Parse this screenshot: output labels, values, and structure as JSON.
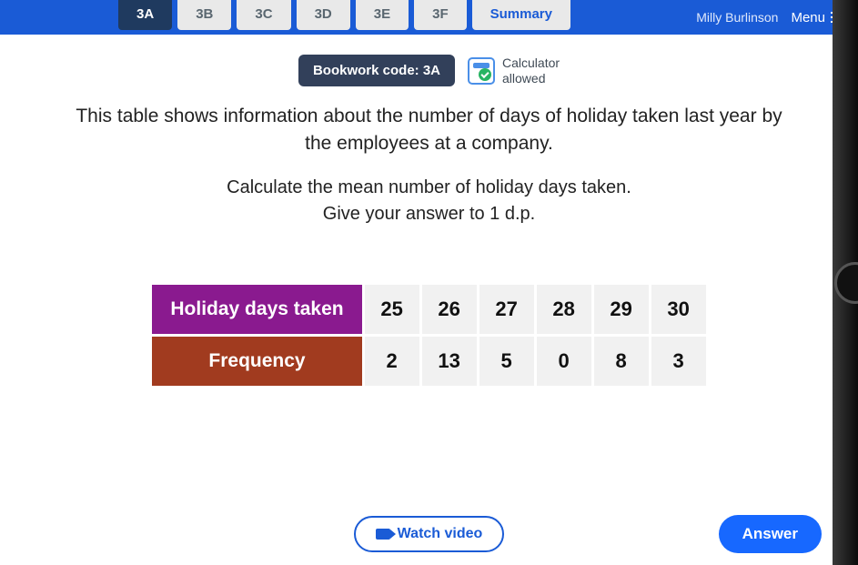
{
  "topbar": {
    "user": "Milly Burlinson",
    "menu": "Menu",
    "tabs": [
      {
        "label": "3A",
        "active": true
      },
      {
        "label": "3B"
      },
      {
        "label": "3C"
      },
      {
        "label": "3D"
      },
      {
        "label": "3E"
      },
      {
        "label": "3F"
      },
      {
        "label": "Summary",
        "summary": true
      }
    ]
  },
  "code_badge": "Bookwork code: 3A",
  "calculator": {
    "line1": "Calculator",
    "line2": "allowed"
  },
  "question_p1": "This table shows information about the number of days of holiday taken last year by the employees at a company.",
  "question_p2": "Calculate the mean number of holiday days taken.",
  "question_p3": "Give your answer to 1 d.p.",
  "table": {
    "row1_label": "Holiday days taken",
    "row2_label": "Frequency",
    "values": [
      "25",
      "26",
      "27",
      "28",
      "29",
      "30"
    ],
    "freqs": [
      "2",
      "13",
      "5",
      "0",
      "8",
      "3"
    ]
  },
  "buttons": {
    "watch": "Watch video",
    "answer": "Answer"
  },
  "chart_data": {
    "type": "table",
    "title": "Number of holiday days taken last year by employees",
    "categories": [
      25,
      26,
      27,
      28,
      29,
      30
    ],
    "values": [
      2,
      13,
      5,
      0,
      8,
      3
    ],
    "xlabel": "Holiday days taken",
    "ylabel": "Frequency"
  }
}
